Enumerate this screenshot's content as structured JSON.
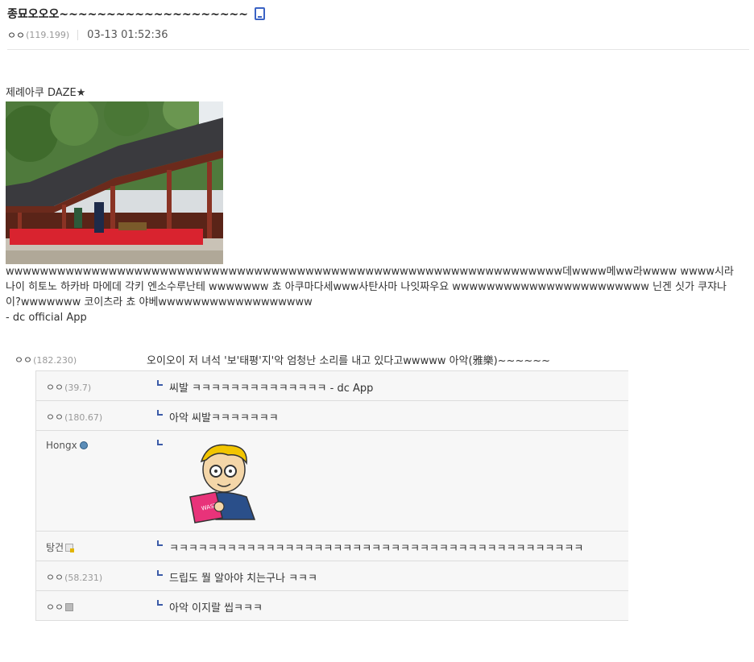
{
  "post": {
    "title": "종묘오오오~~~~~~~~~~~~~~~~~~~~",
    "author": "ㅇㅇ",
    "author_ip": "(119.199)",
    "datetime": "03-13 01:52:36"
  },
  "body": {
    "image_caption": "제례아쿠 DAZE★",
    "text": "wwwwwwwwwwwwwwwwwwwwwwwwwwwwwwwwwwwwwwwwwwwwwwwwwwwwwwwwwwwwwwwww데wwww메ww라wwww wwww시라나이 히토노 하카바 마에데 각키 엔소수루난테 wwwwwww 쵸 아쿠마다세www사탄사마 나잇짜우요 wwwwwwwwwwwwwwwwwwwwwww 닌겐 싯가 쿠쟈나이?wwwwwww 코이츠라 쵸 야베wwwwwwwwwwwwwwwwww",
    "signature": "- dc official App"
  },
  "comments": {
    "top": {
      "nick": "ㅇㅇ",
      "ip": "(182.230)",
      "text": "오이오이 저 녀석 '보'태평'지'악 엄청난 소리를 내고 있다고wwwww 아악(雅樂)~~~~~~"
    },
    "replies": [
      {
        "nick": "ㅇㅇ",
        "ip": "(39.7)",
        "text": "씨발 ㅋㅋㅋㅋㅋㅋㅋㅋㅋㅋㅋㅋㅋㅋ - dc App"
      },
      {
        "nick": "ㅇㅇ",
        "ip": "(180.67)",
        "text": "아악 씨발ㅋㅋㅋㅋㅋㅋㅋ"
      },
      {
        "nick": "Hongx",
        "ip": "",
        "text": ""
      },
      {
        "nick": "탕건",
        "ip": "",
        "text": "ㅋㅋㅋㅋㅋㅋㅋㅋㅋㅋㅋㅋㅋㅋㅋㅋㅋㅋㅋㅋㅋㅋㅋㅋㅋㅋㅋㅋㅋㅋㅋㅋㅋㅋㅋㅋㅋㅋㅋㅋㅋㅋㅋ"
      },
      {
        "nick": "ㅇㅇ",
        "ip": "(58.231)",
        "text": "드립도 뭘 알아야 치는구나 ㅋㅋㅋ"
      },
      {
        "nick": "ㅇㅇ",
        "ip": "",
        "text": "아악 이지랄 씹ㅋㅋㅋ"
      }
    ]
  },
  "icons": {
    "mobile": "mobile-phone-icon",
    "reply_arrow": "reply-arrow-icon",
    "gallog": "gallog-icon",
    "fixed_nick": "fixed-nick-icon"
  },
  "colors": {
    "accent": "#3b5ba8",
    "reply_bg": "#f7f7f7"
  }
}
